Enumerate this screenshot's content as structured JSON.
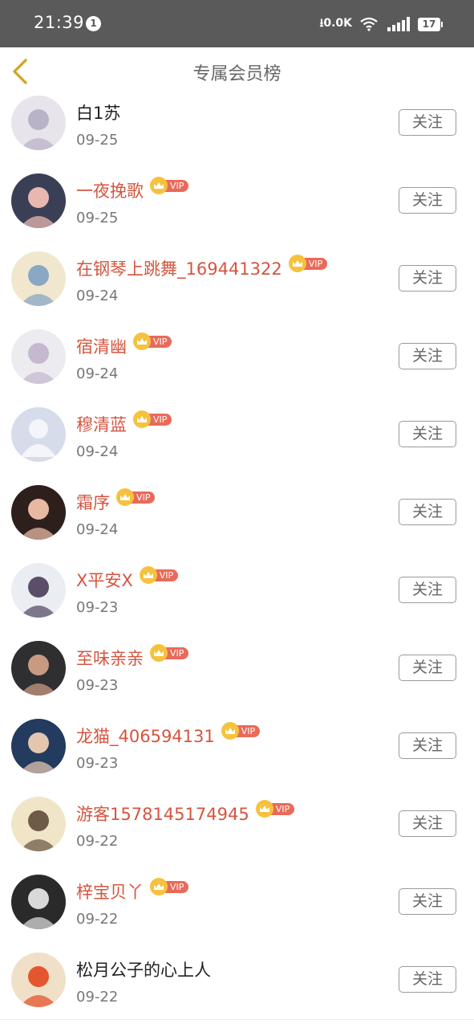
{
  "status_bar": {
    "time": "21:39",
    "notification_count": "1",
    "network_speed": "0.0K",
    "battery": "17"
  },
  "header": {
    "back_icon": "chevron-left-icon",
    "title": "专属会员榜"
  },
  "colors": {
    "status_bar_bg": "#5a5a5a",
    "vip_name": "#d4553f",
    "normal_name": "#222222",
    "vip_badge": "#e96a5a",
    "crown": "#f6c23d",
    "back_arrow": "#e8c34a"
  },
  "vip_label": "VIP",
  "follow_label": "关注",
  "members": [
    {
      "name": "白1苏",
      "date": "09-25",
      "vip": false,
      "avatar_color": "#e7e4ec",
      "avatar_accent": "#b9b3c8"
    },
    {
      "name": "一夜挽歌",
      "date": "09-25",
      "vip": true,
      "avatar_color": "#3a3f55",
      "avatar_accent": "#e8b8b0"
    },
    {
      "name": "在钢琴上跳舞_169441322",
      "date": "09-24",
      "vip": true,
      "avatar_color": "#f1e7cf",
      "avatar_accent": "#8aa7c6"
    },
    {
      "name": "宿清幽",
      "date": "09-24",
      "vip": true,
      "avatar_color": "#ecebf0",
      "avatar_accent": "#c5b9cf"
    },
    {
      "name": "穆清蓝",
      "date": "09-24",
      "vip": true,
      "avatar_color": "#d6dcea",
      "avatar_accent": "#f3f5fa",
      "default_avatar": true
    },
    {
      "name": "霜序",
      "date": "09-24",
      "vip": true,
      "avatar_color": "#2d1f1c",
      "avatar_accent": "#e7b9a3"
    },
    {
      "name": "X平安X",
      "date": "09-23",
      "vip": true,
      "avatar_color": "#eaeef3",
      "avatar_accent": "#5a4e68"
    },
    {
      "name": "至味亲亲",
      "date": "09-23",
      "vip": true,
      "avatar_color": "#2f2f31",
      "avatar_accent": "#c99a82"
    },
    {
      "name": "龙猫_406594131",
      "date": "09-23",
      "vip": true,
      "avatar_color": "#223b5e",
      "avatar_accent": "#e3c6b0"
    },
    {
      "name": "游客1578145174945",
      "date": "09-22",
      "vip": true,
      "avatar_color": "#f1e5c8",
      "avatar_accent": "#6f5a48"
    },
    {
      "name": "梓宝贝丫",
      "date": "09-22",
      "vip": true,
      "avatar_color": "#2a2a2a",
      "avatar_accent": "#d9d9d9"
    },
    {
      "name": "松月公子的心上人",
      "date": "09-22",
      "vip": false,
      "avatar_color": "#f0e0c8",
      "avatar_accent": "#e5562e"
    }
  ]
}
